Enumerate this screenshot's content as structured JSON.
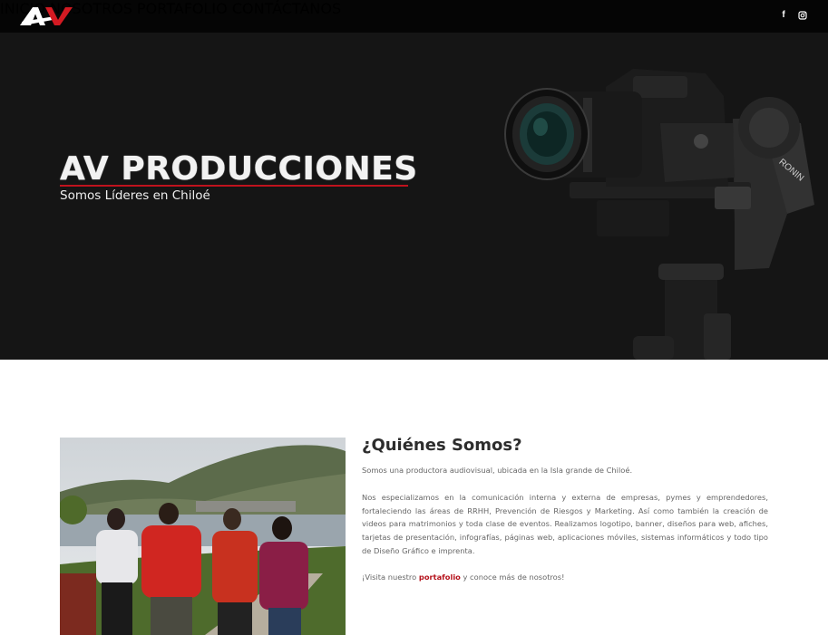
{
  "header": {
    "logo_text": "AV",
    "nav": [
      {
        "label": "INICIO"
      },
      {
        "label": "NOSOTROS"
      },
      {
        "label": "PORTAFOLIO"
      },
      {
        "label": "CONTÁCTANOS"
      }
    ],
    "social": [
      {
        "icon": "facebook-icon",
        "glyph": "f"
      },
      {
        "icon": "instagram-icon",
        "glyph": "◘"
      }
    ]
  },
  "hero": {
    "title": "AV PRODUCCIONES",
    "subtitle": "Somos Líderes en Chiloé",
    "camera_brand": "RONIN"
  },
  "about": {
    "title": "¿Quiénes Somos?",
    "p1": "Somos una productora audiovisual, ubicada en la Isla grande de Chiloé.",
    "p2": "Nos especializamos en la comunicación interna y externa de empresas, pymes y emprendedores, fortaleciendo las áreas de RRHH, Prevención de Riesgos y Marketing. Así como también la creación de videos para matrimonios y toda clase de eventos. Realizamos logotipo, banner, diseños para web, afiches, tarjetas de presentación, infografías, páginas web, aplicaciones móviles, sistemas informáticos y todo tipo de Diseño Gráfico e imprenta.",
    "p3_before": "¡Visita nuestro ",
    "p3_link": "portafolio",
    "p3_after": " y conoce más de nosotros!"
  },
  "colors": {
    "accent": "#c0121d",
    "header_bg": "#050505",
    "hero_bg": "#151515"
  }
}
